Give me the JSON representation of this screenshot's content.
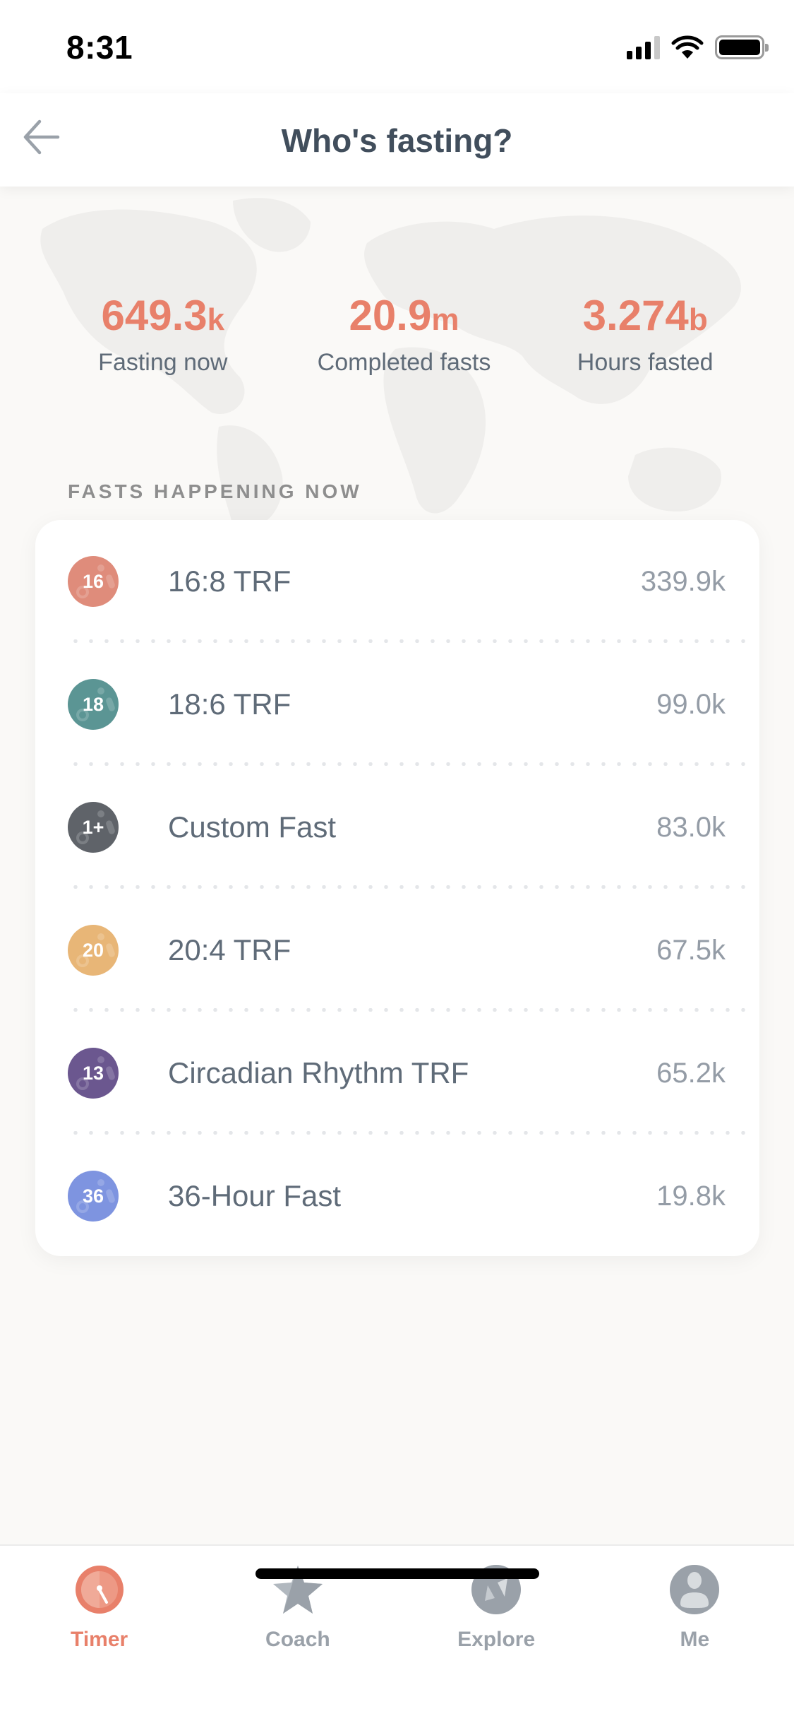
{
  "status_bar": {
    "time": "8:31"
  },
  "nav": {
    "title": "Who's fasting?",
    "back_icon": "arrow-left-icon"
  },
  "stats": [
    {
      "value": "649.3",
      "unit": "k",
      "label": "Fasting now"
    },
    {
      "value": "20.9",
      "unit": "m",
      "label": "Completed fasts"
    },
    {
      "value": "3.274",
      "unit": "b",
      "label": "Hours fasted"
    }
  ],
  "section_title": "FASTS HAPPENING NOW",
  "fasts": [
    {
      "badge": "16",
      "name": "16:8 TRF",
      "count": "339.9k",
      "color": "#df8c7b"
    },
    {
      "badge": "18",
      "name": "18:6 TRF",
      "count": "99.0k",
      "color": "#5b9594"
    },
    {
      "badge": "1+",
      "name": "Custom Fast",
      "count": "83.0k",
      "color": "#5f6369"
    },
    {
      "badge": "20",
      "name": "20:4 TRF",
      "count": "67.5k",
      "color": "#e8b677"
    },
    {
      "badge": "13",
      "name": "Circadian Rhythm TRF",
      "count": "65.2k",
      "color": "#6b578f"
    },
    {
      "badge": "36",
      "name": "36-Hour Fast",
      "count": "19.8k",
      "color": "#7e94e0"
    }
  ],
  "tabs": [
    {
      "label": "Timer",
      "icon": "timer-icon",
      "active": true
    },
    {
      "label": "Coach",
      "icon": "star-icon",
      "active": false
    },
    {
      "label": "Explore",
      "icon": "compass-icon",
      "active": false
    },
    {
      "label": "Me",
      "icon": "person-icon",
      "active": false
    }
  ],
  "colors": {
    "accent": "#e8806a",
    "inactive_tab": "#9aa1a9",
    "title": "#414e5c",
    "background": "#faf9f7"
  }
}
